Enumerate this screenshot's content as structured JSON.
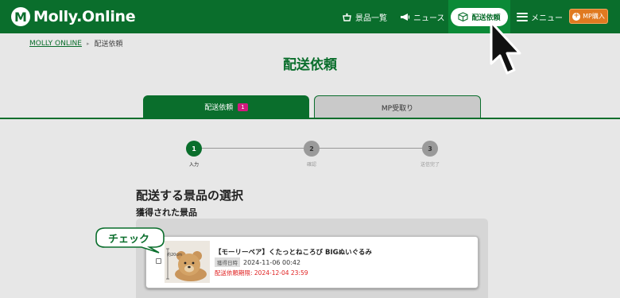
{
  "header": {
    "logo_mark": "M",
    "logo_text": "Molly.Online",
    "nav": {
      "prize_list": "景品一覧",
      "news": "ニュース",
      "delivery": "配送依頼",
      "menu": "メニュー",
      "mp_purchase": "MP購入",
      "mp_plus": "+"
    }
  },
  "breadcrumb": {
    "home": "MOLLY ONLINE",
    "separator": "▸",
    "current": "配送依頼"
  },
  "page_title": "配送依頼",
  "tabs": [
    {
      "label": "配送依頼",
      "badge": "1",
      "active": true
    },
    {
      "label": "MP受取り",
      "active": false
    }
  ],
  "steps": [
    {
      "number": "1",
      "label": "入力",
      "active": true
    },
    {
      "number": "2",
      "label": "確認",
      "active": false
    },
    {
      "number": "3",
      "label": "送信完了",
      "active": false
    }
  ],
  "section": {
    "title": "配送する景品の選択",
    "subtitle": "獲得された景品"
  },
  "item": {
    "size_label": "約20cm",
    "name": "【モーリーベア】くたっとねころび BIGぬいぐるみ",
    "acquired_label": "獲得日時",
    "acquired_date": "2024-11-06 00:42",
    "deadline": "配送依頼期限: 2024-12-04 23:59",
    "checked": false
  },
  "callout": {
    "text": "チェック"
  },
  "colors": {
    "brand_green": "#0a6e2c",
    "active_nav": "#0b8a37",
    "badge_pink": "#d11a7e",
    "mp_orange": "#e07a20",
    "deadline_red": "#e02020"
  },
  "icons": {
    "prize": "gift-hanger-icon",
    "news": "megaphone-icon",
    "delivery": "box-icon",
    "menu": "hamburger-icon",
    "cursor": "arrow-pointer-icon"
  }
}
